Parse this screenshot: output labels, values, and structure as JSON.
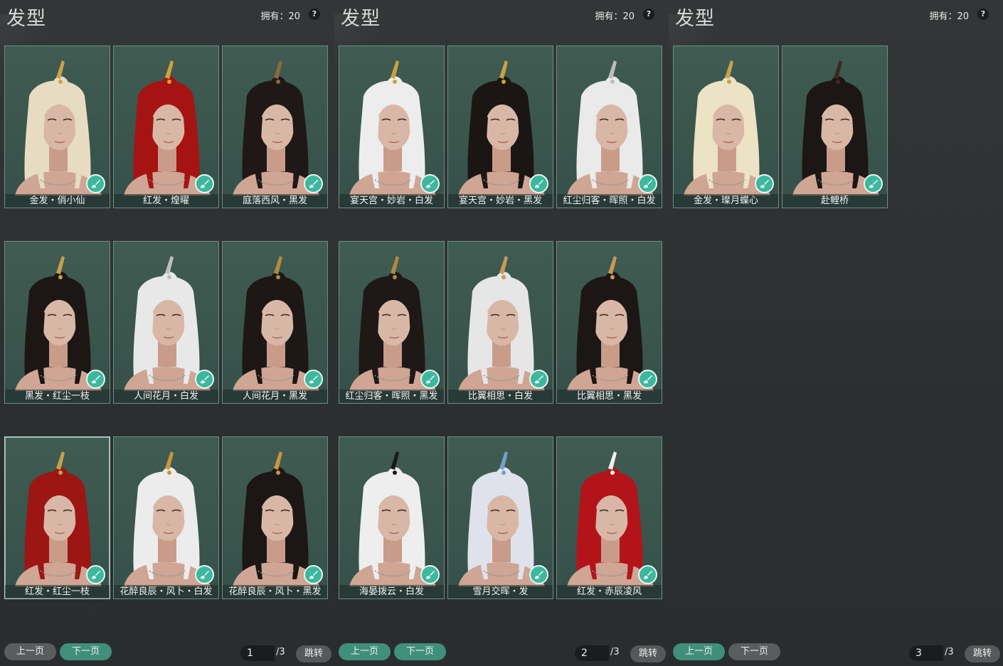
{
  "panels": [
    {
      "title": "发型",
      "owned_text": "拥有：20",
      "help": "?",
      "page_value": "1",
      "page_total": "/3",
      "prev_label": "上一页",
      "next_label": "下一页",
      "jump_label": "跳转",
      "active_button": "next",
      "cards": [
        {
          "label": "金发・俏小仙",
          "hair_color": "#e7dcc2",
          "accent": "#c9a24a",
          "selected": false
        },
        {
          "label": "红发・煌曜",
          "hair_color": "#a51412",
          "accent": "#d3a03a",
          "selected": false
        },
        {
          "label": "庭落西风・黑发",
          "hair_color": "#1f1816",
          "accent": "#8a6a3a",
          "selected": false
        },
        {
          "label": "黑发・红尘一枝",
          "hair_color": "#1c1614",
          "accent": "#c7a04a",
          "selected": false
        },
        {
          "label": "人间花月・白发",
          "hair_color": "#e8e8e8",
          "accent": "#bfbfbf",
          "selected": false
        },
        {
          "label": "人间花月・黑发",
          "hair_color": "#1d1715",
          "accent": "#b08a40",
          "selected": false
        },
        {
          "label": "红发・红尘一枝",
          "hair_color": "#9c1614",
          "accent": "#c7a04a",
          "selected": true
        },
        {
          "label": "花醉良辰・风卜・白发",
          "hair_color": "#ececec",
          "accent": "#c9963a",
          "selected": false
        },
        {
          "label": "花醉良辰・风卜・黑发",
          "hair_color": "#1c1614",
          "accent": "#c9963a",
          "selected": false
        }
      ]
    },
    {
      "title": "发型",
      "owned_text": "拥有：20",
      "help": "?",
      "page_value": "2",
      "page_total": "/3",
      "prev_label": "上一页",
      "next_label": "下一页",
      "jump_label": "跳转",
      "active_button": "both",
      "cards": [
        {
          "label": "宴天宫・妙岩・白发",
          "hair_color": "#ededed",
          "accent": "#caa240",
          "selected": false
        },
        {
          "label": "宴天宫・妙岩・黑发",
          "hair_color": "#1b1614",
          "accent": "#caa240",
          "selected": false
        },
        {
          "label": "红尘归客・晖照・白发",
          "hair_color": "#eaeaea",
          "accent": "#bdbdbd",
          "selected": false
        },
        {
          "label": "红尘归客・晖照・黑发",
          "hair_color": "#1e1816",
          "accent": "#b08a40",
          "selected": false
        },
        {
          "label": "比翼相思・白发",
          "hair_color": "#e6e6e6",
          "accent": "#c99a58",
          "selected": false
        },
        {
          "label": "比翼相思・黑发",
          "hair_color": "#1c1614",
          "accent": "#c99a58",
          "selected": false
        },
        {
          "label": "海晏拨云・白发",
          "hair_color": "#eeeeee",
          "accent": "#1a1a1a",
          "selected": false
        },
        {
          "label": "雪月交晖・发",
          "hair_color": "#dfe2ea",
          "accent": "#6fa2c8",
          "selected": false
        },
        {
          "label": "红发・赤辰凌风",
          "hair_color": "#b3141a",
          "accent": "#f0f0f0",
          "selected": false
        }
      ]
    },
    {
      "title": "发型",
      "owned_text": "拥有：20",
      "help": "?",
      "page_value": "3",
      "page_total": "/3",
      "prev_label": "上一页",
      "next_label": "下一页",
      "jump_label": "跳转",
      "active_button": "prev",
      "cards": [
        {
          "label": "金发・璨月蝶心",
          "hair_color": "#ece2c4",
          "accent": "#c9a24a",
          "selected": false
        },
        {
          "label": "赴鲤桥",
          "hair_color": "#1c1614",
          "accent": "#3b2a22",
          "selected": false
        }
      ]
    }
  ],
  "icons": {
    "help": "question-mark-icon",
    "dye": "brush-icon"
  },
  "colors": {
    "card_bg": "#3a554c",
    "card_border": "#6a8f84",
    "active_button": "#3f8f7c",
    "inactive_button": "#5a5d5e",
    "dye_badge": "#3cb89e"
  }
}
